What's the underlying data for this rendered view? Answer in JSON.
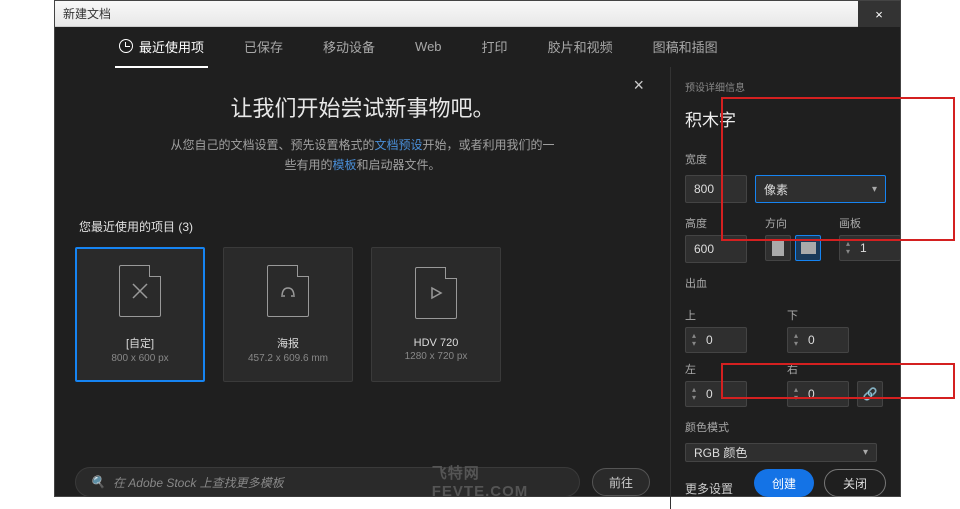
{
  "titlebar": {
    "title": "新建文档",
    "close": "×"
  },
  "tabs": [
    "最近使用项",
    "已保存",
    "移动设备",
    "Web",
    "打印",
    "胶片和视频",
    "图稿和插图"
  ],
  "intro": {
    "close": "×",
    "heading": "让我们开始尝试新事物吧。",
    "line1a": "从您自己的文档设置、预先设置格式的",
    "line1b": "文档预设",
    "line1c": "开始，或者利用我们的一",
    "line2a": "些有用的",
    "line2b": "模板",
    "line2c": "和启动器文件。"
  },
  "recent": {
    "label": "您最近使用的项目 (3)",
    "cards": [
      {
        "title": "[自定]",
        "sub": "800 x 600 px"
      },
      {
        "title": "海报",
        "sub": "457.2 x 609.6 mm"
      },
      {
        "title": "HDV 720",
        "sub": "1280 x 720 px"
      }
    ]
  },
  "search": {
    "placeholder": "在 Adobe Stock 上查找更多模板",
    "go": "前往"
  },
  "details": {
    "section": "预设详细信息",
    "name": "积木字",
    "width_label": "宽度",
    "width": "800",
    "unit": "像素",
    "height_label": "高度",
    "height": "600",
    "orient_label": "方向",
    "artboard_label": "画板",
    "artboard": "1",
    "bleed_label": "出血",
    "top": "上",
    "bottom": "下",
    "left": "左",
    "right": "右",
    "zero": "0",
    "colormode_label": "颜色模式",
    "colormode": "RGB 颜色",
    "more": "更多设置"
  },
  "buttons": {
    "create": "创建",
    "close": "关闭"
  },
  "watermark": "FEVTE.COM",
  "wm2": "飞特网"
}
